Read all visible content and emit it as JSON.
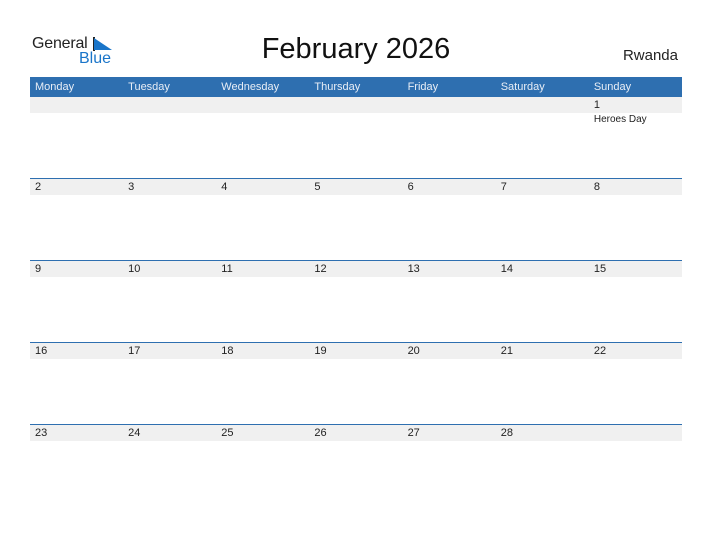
{
  "logo": {
    "line1": "General",
    "line2": "Blue"
  },
  "title": "February 2026",
  "country": "Rwanda",
  "weekdays": [
    "Monday",
    "Tuesday",
    "Wednesday",
    "Thursday",
    "Friday",
    "Saturday",
    "Sunday"
  ],
  "weeks": [
    {
      "days": [
        "",
        "",
        "",
        "",
        "",
        "",
        "1"
      ],
      "events": [
        "",
        "",
        "",
        "",
        "",
        "",
        "Heroes Day"
      ]
    },
    {
      "days": [
        "2",
        "3",
        "4",
        "5",
        "6",
        "7",
        "8"
      ],
      "events": [
        "",
        "",
        "",
        "",
        "",
        "",
        ""
      ]
    },
    {
      "days": [
        "9",
        "10",
        "11",
        "12",
        "13",
        "14",
        "15"
      ],
      "events": [
        "",
        "",
        "",
        "",
        "",
        "",
        ""
      ]
    },
    {
      "days": [
        "16",
        "17",
        "18",
        "19",
        "20",
        "21",
        "22"
      ],
      "events": [
        "",
        "",
        "",
        "",
        "",
        "",
        ""
      ]
    },
    {
      "days": [
        "23",
        "24",
        "25",
        "26",
        "27",
        "28",
        ""
      ],
      "events": [
        "",
        "",
        "",
        "",
        "",
        "",
        ""
      ]
    }
  ],
  "colors": {
    "header": "#2e6fb0",
    "brand_blue": "#1a75c9",
    "strip": "#f0f0f0"
  }
}
